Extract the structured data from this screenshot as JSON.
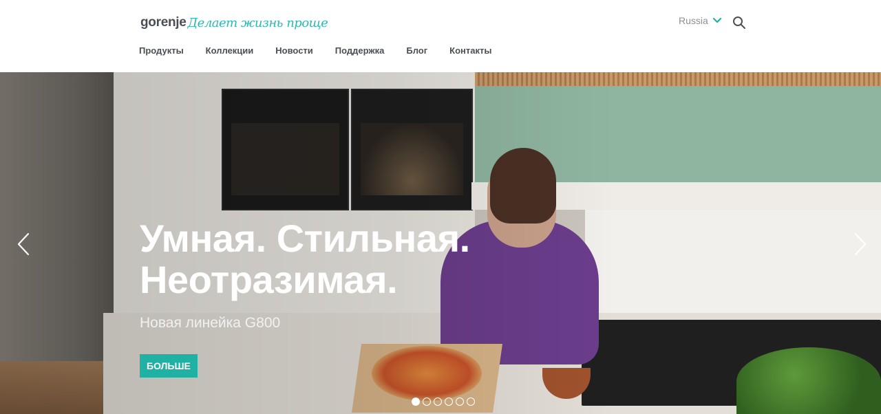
{
  "header": {
    "logo_brand": "gorenje",
    "logo_slogan": "Делает жизнь проще",
    "language": "Russia",
    "nav": [
      "Продукты",
      "Коллекции",
      "Новости",
      "Поддержка",
      "Блог",
      "Контакты"
    ]
  },
  "hero": {
    "title_line1": "Умная. Стильная.",
    "title_line2": "Неотразимая.",
    "subtitle": "Новая линейка G800",
    "button_label": "БОЛЬШЕ",
    "slides_count": 6,
    "active_slide": 1
  },
  "colors": {
    "accent": "#1fb1a4",
    "nav_text": "#4a4f55",
    "language_text": "#8a9096"
  },
  "icons": {
    "language_toggle": "chevron-down-icon",
    "search": "search-icon",
    "prev": "chevron-left-icon",
    "next": "chevron-right-icon"
  }
}
